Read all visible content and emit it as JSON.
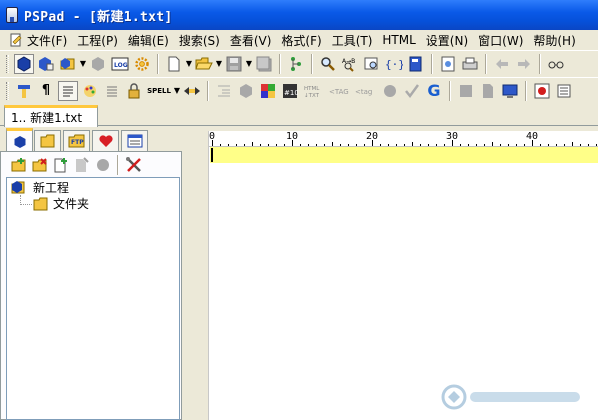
{
  "window": {
    "title": "PSPad - [新建1.txt]"
  },
  "menu": {
    "items": [
      {
        "label": "文件(F)",
        "icon": "new-document-icon"
      },
      {
        "label": "工程(P)"
      },
      {
        "label": "编辑(E)"
      },
      {
        "label": "搜索(S)"
      },
      {
        "label": "查看(V)"
      },
      {
        "label": "格式(F)"
      },
      {
        "label": "工具(T)"
      },
      {
        "label": "HTML"
      },
      {
        "label": "设置(N)"
      },
      {
        "label": "窗口(W)"
      },
      {
        "label": "帮助(H)"
      }
    ]
  },
  "toolbar2": {
    "spell_label": "SPELL"
  },
  "tabs": {
    "document": "1.. 新建1.txt"
  },
  "panel": {
    "tab_ftp_label": "FTP",
    "tree": [
      {
        "label": "新工程",
        "icon": "project-icon"
      },
      {
        "label": "文件夹",
        "icon": "folder-icon"
      }
    ]
  },
  "ruler": {
    "marks": [
      "0",
      "10",
      "20",
      "30",
      "40"
    ]
  },
  "colors": {
    "titlebar": "#0a5ae8",
    "current_line": "#ffff88",
    "tab_accent": "#ffc83d"
  }
}
